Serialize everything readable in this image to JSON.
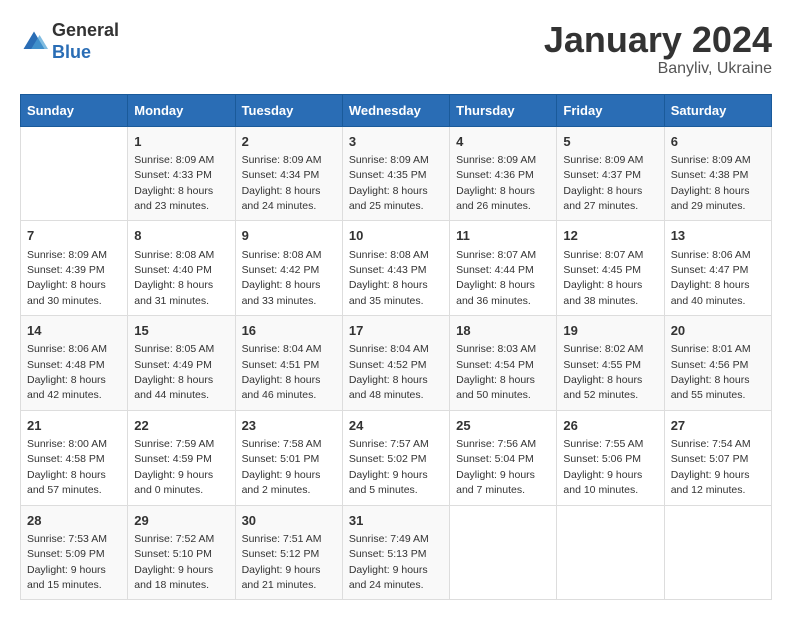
{
  "logo": {
    "general": "General",
    "blue": "Blue"
  },
  "title": "January 2024",
  "location": "Banyliv, Ukraine",
  "days_of_week": [
    "Sunday",
    "Monday",
    "Tuesday",
    "Wednesday",
    "Thursday",
    "Friday",
    "Saturday"
  ],
  "weeks": [
    [
      {
        "day": "",
        "info": ""
      },
      {
        "day": "1",
        "info": "Sunrise: 8:09 AM\nSunset: 4:33 PM\nDaylight: 8 hours\nand 23 minutes."
      },
      {
        "day": "2",
        "info": "Sunrise: 8:09 AM\nSunset: 4:34 PM\nDaylight: 8 hours\nand 24 minutes."
      },
      {
        "day": "3",
        "info": "Sunrise: 8:09 AM\nSunset: 4:35 PM\nDaylight: 8 hours\nand 25 minutes."
      },
      {
        "day": "4",
        "info": "Sunrise: 8:09 AM\nSunset: 4:36 PM\nDaylight: 8 hours\nand 26 minutes."
      },
      {
        "day": "5",
        "info": "Sunrise: 8:09 AM\nSunset: 4:37 PM\nDaylight: 8 hours\nand 27 minutes."
      },
      {
        "day": "6",
        "info": "Sunrise: 8:09 AM\nSunset: 4:38 PM\nDaylight: 8 hours\nand 29 minutes."
      }
    ],
    [
      {
        "day": "7",
        "info": "Sunrise: 8:09 AM\nSunset: 4:39 PM\nDaylight: 8 hours\nand 30 minutes."
      },
      {
        "day": "8",
        "info": "Sunrise: 8:08 AM\nSunset: 4:40 PM\nDaylight: 8 hours\nand 31 minutes."
      },
      {
        "day": "9",
        "info": "Sunrise: 8:08 AM\nSunset: 4:42 PM\nDaylight: 8 hours\nand 33 minutes."
      },
      {
        "day": "10",
        "info": "Sunrise: 8:08 AM\nSunset: 4:43 PM\nDaylight: 8 hours\nand 35 minutes."
      },
      {
        "day": "11",
        "info": "Sunrise: 8:07 AM\nSunset: 4:44 PM\nDaylight: 8 hours\nand 36 minutes."
      },
      {
        "day": "12",
        "info": "Sunrise: 8:07 AM\nSunset: 4:45 PM\nDaylight: 8 hours\nand 38 minutes."
      },
      {
        "day": "13",
        "info": "Sunrise: 8:06 AM\nSunset: 4:47 PM\nDaylight: 8 hours\nand 40 minutes."
      }
    ],
    [
      {
        "day": "14",
        "info": "Sunrise: 8:06 AM\nSunset: 4:48 PM\nDaylight: 8 hours\nand 42 minutes."
      },
      {
        "day": "15",
        "info": "Sunrise: 8:05 AM\nSunset: 4:49 PM\nDaylight: 8 hours\nand 44 minutes."
      },
      {
        "day": "16",
        "info": "Sunrise: 8:04 AM\nSunset: 4:51 PM\nDaylight: 8 hours\nand 46 minutes."
      },
      {
        "day": "17",
        "info": "Sunrise: 8:04 AM\nSunset: 4:52 PM\nDaylight: 8 hours\nand 48 minutes."
      },
      {
        "day": "18",
        "info": "Sunrise: 8:03 AM\nSunset: 4:54 PM\nDaylight: 8 hours\nand 50 minutes."
      },
      {
        "day": "19",
        "info": "Sunrise: 8:02 AM\nSunset: 4:55 PM\nDaylight: 8 hours\nand 52 minutes."
      },
      {
        "day": "20",
        "info": "Sunrise: 8:01 AM\nSunset: 4:56 PM\nDaylight: 8 hours\nand 55 minutes."
      }
    ],
    [
      {
        "day": "21",
        "info": "Sunrise: 8:00 AM\nSunset: 4:58 PM\nDaylight: 8 hours\nand 57 minutes."
      },
      {
        "day": "22",
        "info": "Sunrise: 7:59 AM\nSunset: 4:59 PM\nDaylight: 9 hours\nand 0 minutes."
      },
      {
        "day": "23",
        "info": "Sunrise: 7:58 AM\nSunset: 5:01 PM\nDaylight: 9 hours\nand 2 minutes."
      },
      {
        "day": "24",
        "info": "Sunrise: 7:57 AM\nSunset: 5:02 PM\nDaylight: 9 hours\nand 5 minutes."
      },
      {
        "day": "25",
        "info": "Sunrise: 7:56 AM\nSunset: 5:04 PM\nDaylight: 9 hours\nand 7 minutes."
      },
      {
        "day": "26",
        "info": "Sunrise: 7:55 AM\nSunset: 5:06 PM\nDaylight: 9 hours\nand 10 minutes."
      },
      {
        "day": "27",
        "info": "Sunrise: 7:54 AM\nSunset: 5:07 PM\nDaylight: 9 hours\nand 12 minutes."
      }
    ],
    [
      {
        "day": "28",
        "info": "Sunrise: 7:53 AM\nSunset: 5:09 PM\nDaylight: 9 hours\nand 15 minutes."
      },
      {
        "day": "29",
        "info": "Sunrise: 7:52 AM\nSunset: 5:10 PM\nDaylight: 9 hours\nand 18 minutes."
      },
      {
        "day": "30",
        "info": "Sunrise: 7:51 AM\nSunset: 5:12 PM\nDaylight: 9 hours\nand 21 minutes."
      },
      {
        "day": "31",
        "info": "Sunrise: 7:49 AM\nSunset: 5:13 PM\nDaylight: 9 hours\nand 24 minutes."
      },
      {
        "day": "",
        "info": ""
      },
      {
        "day": "",
        "info": ""
      },
      {
        "day": "",
        "info": ""
      }
    ]
  ]
}
